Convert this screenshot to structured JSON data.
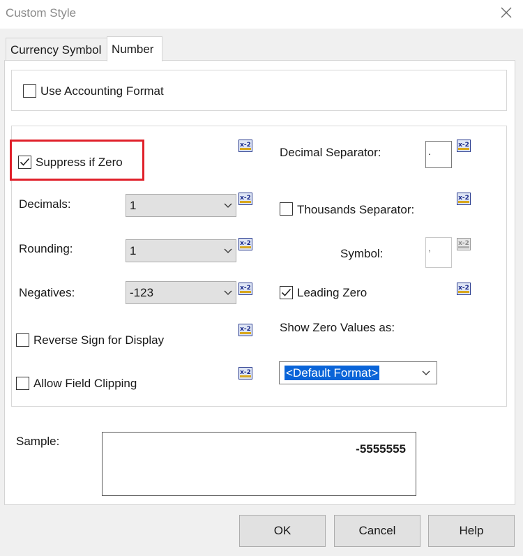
{
  "window": {
    "title": "Custom Style"
  },
  "tabs": [
    {
      "label": "Currency Symbol"
    },
    {
      "label": "Number"
    }
  ],
  "accounting": {
    "label": "Use Accounting Format",
    "checked": false
  },
  "suppress": {
    "label": "Suppress if Zero",
    "checked": true
  },
  "decimals": {
    "label": "Decimals:",
    "value": "1"
  },
  "rounding": {
    "label": "Rounding:",
    "value": "1"
  },
  "negatives": {
    "label": "Negatives:",
    "value": "-123"
  },
  "reverse_sign": {
    "label": "Reverse Sign for Display",
    "checked": false
  },
  "allow_clipping": {
    "label": "Allow Field Clipping",
    "checked": false
  },
  "decimal_separator": {
    "label": "Decimal Separator:",
    "value": "."
  },
  "thousands_separator": {
    "label": "Thousands Separator:",
    "checked": false
  },
  "symbol": {
    "label": "Symbol:",
    "value": ","
  },
  "leading_zero": {
    "label": "Leading Zero",
    "checked": true
  },
  "show_zero": {
    "label": "Show Zero Values as:",
    "value": "<Default Format>"
  },
  "sample": {
    "label": "Sample:",
    "value": "-5555555"
  },
  "buttons": {
    "ok": "OK",
    "cancel": "Cancel",
    "help": "Help"
  },
  "icons": {
    "formula": "formula-x2-icon",
    "close": "close-icon",
    "dropdown": "chevron-down-icon",
    "check": "check-icon"
  },
  "colors": {
    "highlight": "#e0202a",
    "selection": "#0a64d8"
  }
}
